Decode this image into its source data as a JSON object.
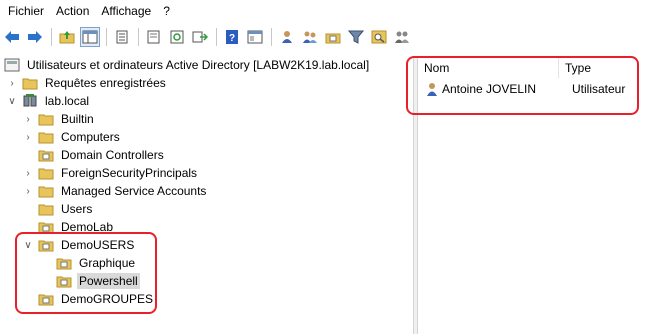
{
  "menu": [
    "Fichier",
    "Action",
    "Affichage",
    "?"
  ],
  "toolbar": {
    "icons": [
      "back-arrow-icon",
      "forward-arrow-icon",
      "up-folder-icon",
      "show-console-tree-icon",
      "properties-icon",
      "export-list-icon",
      "refresh-icon",
      "export-icon",
      "help-icon",
      "view-icon",
      "user-icon",
      "group-icon",
      "new-ou-icon",
      "filter-icon",
      "find-icon",
      "add-to-group-icon"
    ]
  },
  "tree": {
    "root": "Utilisateurs et ordinateurs Active Directory [LABW2K19.lab.local]",
    "saved_queries": "Requêtes enregistrées",
    "domain": "lab.local",
    "items": {
      "builtin": "Builtin",
      "computers": "Computers",
      "domain_controllers": "Domain Controllers",
      "foreign": "ForeignSecurityPrincipals",
      "msa": "Managed Service Accounts",
      "users": "Users",
      "demolab": "DemoLab",
      "demousers": "DemoUSERS",
      "graphique": "Graphique",
      "powershell": "Powershell",
      "demogroupes": "DemoGROUPES"
    }
  },
  "list": {
    "columns": [
      "Nom",
      "Type"
    ],
    "rows": [
      {
        "name": "Antoine JOVELIN",
        "type": "Utilisateur"
      }
    ]
  },
  "colors": {
    "highlight": "#e8202a",
    "folder": "#e8c55a",
    "selected_bg": "#d9d9d9"
  }
}
